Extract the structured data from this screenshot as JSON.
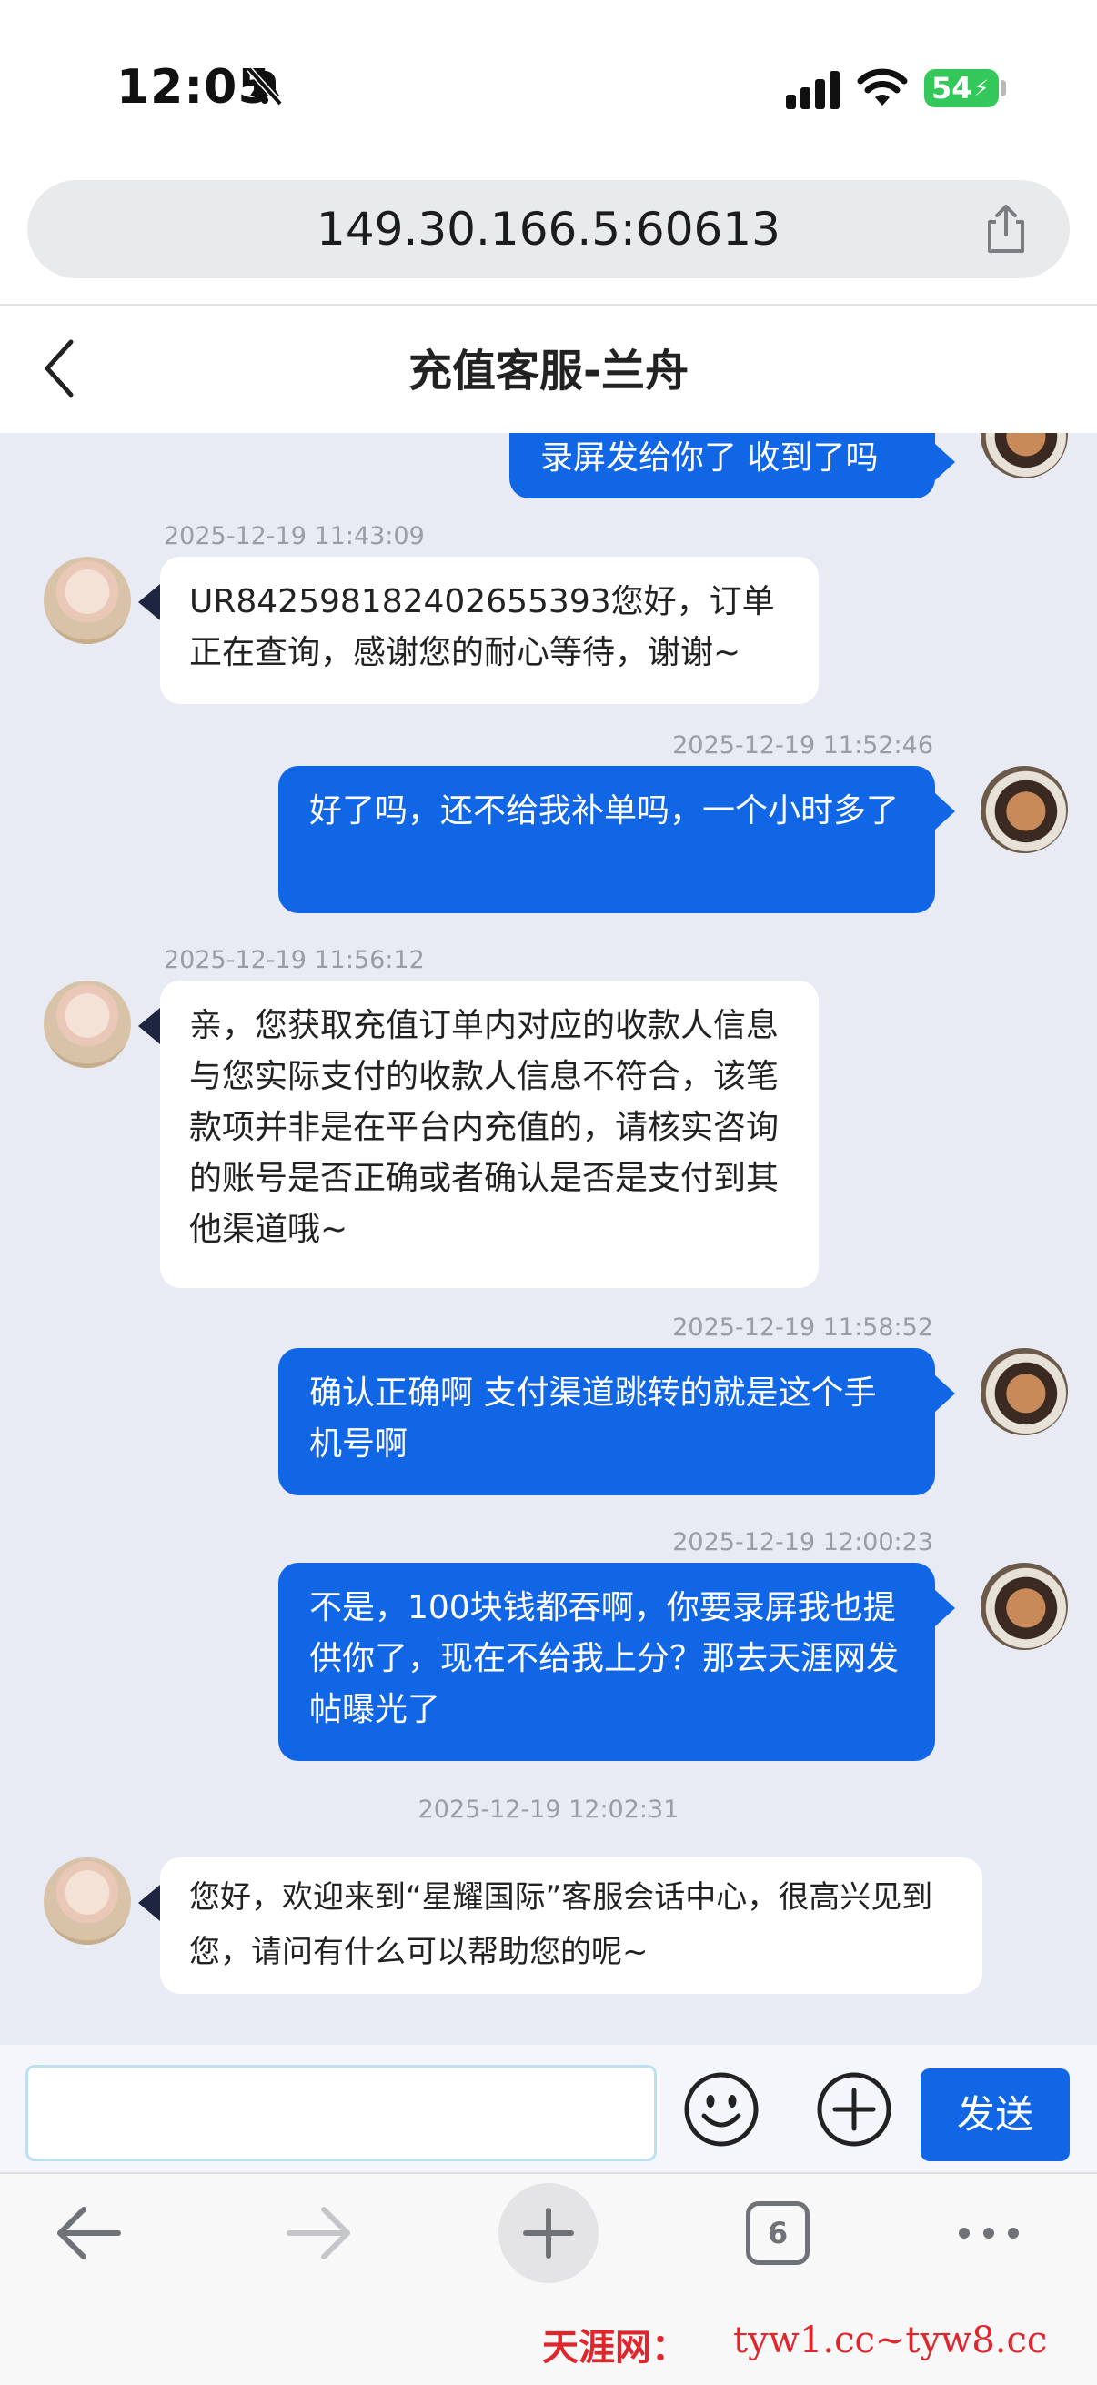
{
  "status_bar": {
    "time": "12:05",
    "battery": "54"
  },
  "browser": {
    "url": "149.30.166.5:60613",
    "tab_count": "6"
  },
  "chat": {
    "title": "充值客服-兰舟",
    "messages": [
      {
        "side": "out",
        "timestamp": "",
        "text": "录屏发给你了 收到了吗"
      },
      {
        "side": "in",
        "timestamp": "2025-12-19 11:43:09",
        "text": "UR842598182402655393您好，订单正在查询，感谢您的耐心等待，谢谢~"
      },
      {
        "side": "out",
        "timestamp": "2025-12-19 11:52:46",
        "text": "好了吗，还不给我补单吗，一个小时多了"
      },
      {
        "side": "in",
        "timestamp": "2025-12-19 11:56:12",
        "text": "亲，您获取充值订单内对应的收款人信息与您实际支付的收款人信息不符合，该笔款项并非是在平台内充值的，请核实咨询的账号是否正确或者确认是否是支付到其他渠道哦~"
      },
      {
        "side": "out",
        "timestamp": "2025-12-19 11:58:52",
        "text": "确认正确啊 支付渠道跳转的就是这个手机号啊"
      },
      {
        "side": "out",
        "timestamp": "2025-12-19 12:00:23",
        "text": "不是，100块钱都吞啊，你要录屏我也提供你了，现在不给我上分？那去天涯网发帖曝光了"
      },
      {
        "side": "in",
        "timestamp": "2025-12-19 12:02:31",
        "text": "您好，欢迎来到“星耀国际”客服会话中心，很高兴见到您，请问有什么可以帮助您的呢~"
      }
    ]
  },
  "composer": {
    "placeholder": "",
    "send_label": "发送"
  },
  "watermark": {
    "brand": "天涯网：",
    "urls": "tyw1.cc~tyw8.cc"
  },
  "colors": {
    "accent": "#1166e6",
    "chat_bg": "#e8eaf4",
    "watermark": "#e0262d"
  },
  "icons": [
    "bell-slash-icon",
    "cellular-signal-icon",
    "wifi-icon",
    "share-icon",
    "chevron-left-icon",
    "smiley-icon",
    "plus-circle-icon",
    "arrow-left-icon",
    "arrow-right-icon",
    "plus-icon",
    "tabs-icon",
    "more-icon"
  ]
}
